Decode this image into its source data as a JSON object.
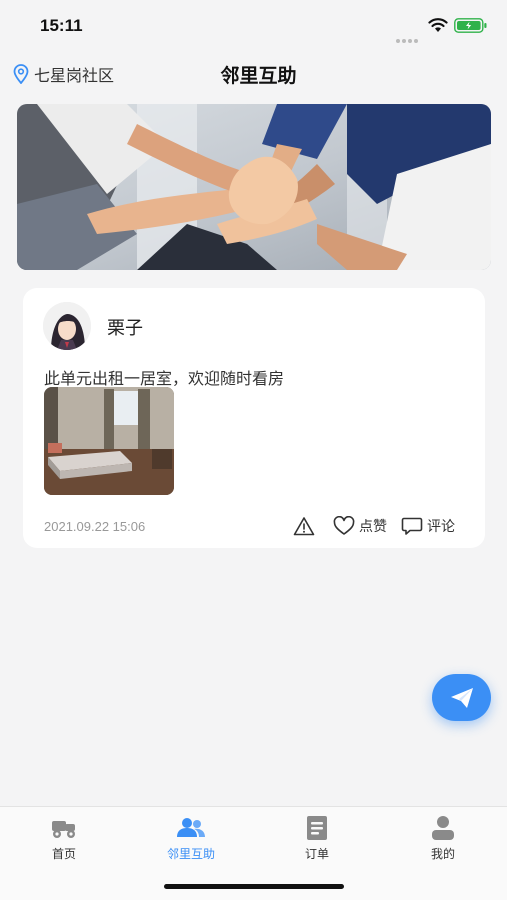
{
  "status_bar": {
    "time": "15:11"
  },
  "header": {
    "location": "七星岗社区",
    "title": "邻里互助"
  },
  "post": {
    "author": "栗子",
    "content": "此单元出租一居室，欢迎随时看房",
    "timestamp": "2021.09.22 15:06",
    "like_label": "点赞",
    "comment_label": "评论"
  },
  "tabs": [
    {
      "label": "首页",
      "icon": "scooter-icon",
      "active": false
    },
    {
      "label": "邻里互助",
      "icon": "people-icon",
      "active": true
    },
    {
      "label": "订单",
      "icon": "order-icon",
      "active": false
    },
    {
      "label": "我的",
      "icon": "user-icon",
      "active": false
    }
  ],
  "colors": {
    "accent": "#3b8ff5",
    "background": "#f4f4f5",
    "card": "#ffffff"
  }
}
